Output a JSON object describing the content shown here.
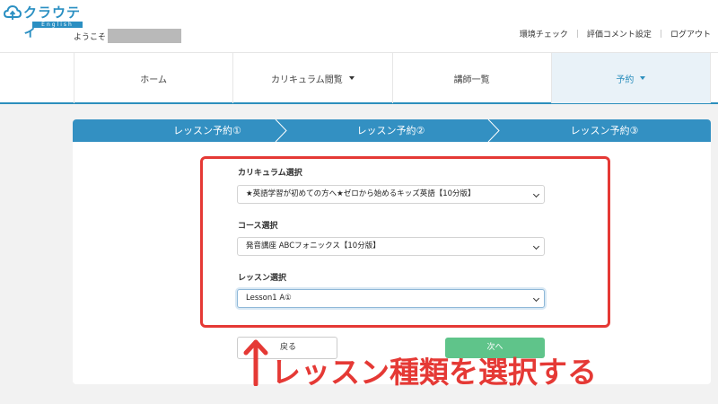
{
  "logo": {
    "text": "クラウティ",
    "sub": "English"
  },
  "header": {
    "welcome_prefix": "ようこそ",
    "links": [
      "環境チェック",
      "評価コメント設定",
      "ログアウト"
    ]
  },
  "nav": {
    "items": [
      {
        "label": "ホーム",
        "has_caret": false,
        "active": false
      },
      {
        "label": "カリキュラム閲覧",
        "has_caret": true,
        "active": false
      },
      {
        "label": "講師一覧",
        "has_caret": false,
        "active": false
      },
      {
        "label": "予約",
        "has_caret": true,
        "active": true
      }
    ]
  },
  "steps": [
    "レッスン予約①",
    "レッスン予約②",
    "レッスン予約③"
  ],
  "form": {
    "curriculum_label": "カリキュラム選択",
    "curriculum_value": "★英語学習が初めての方へ★ゼロから始めるキッズ英語【10分版】",
    "course_label": "コース選択",
    "course_value": "発音講座 ABCフォニックス【10分版】",
    "lesson_label": "レッスン選択",
    "lesson_value": "Lesson1 A①"
  },
  "buttons": {
    "back": "戻る",
    "next": "次へ"
  },
  "annotation": "レッスン種類を選択する",
  "colors": {
    "brand": "#2c8fbd",
    "step_bar": "#3390c2",
    "highlight": "#e53935",
    "next_button": "#5fc48a"
  }
}
